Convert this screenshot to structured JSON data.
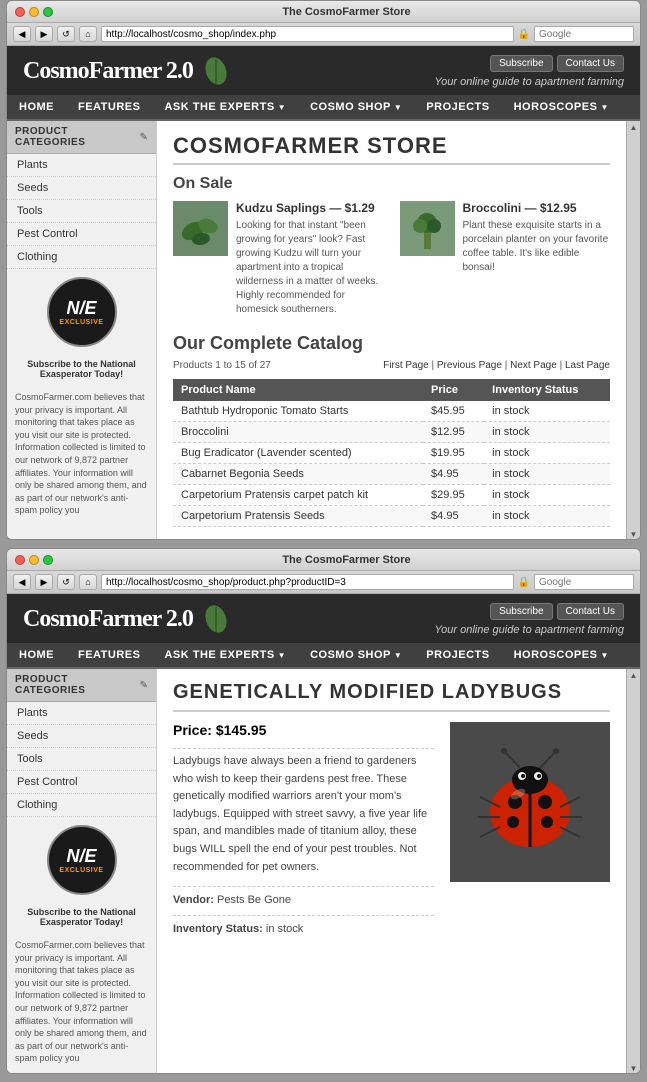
{
  "window1": {
    "title": "The CosmoFarmer Store",
    "url": "http://localhost/cosmo_shop/index.php",
    "search_placeholder": "Google",
    "header": {
      "logo": "CosmoFarmer 2.0",
      "tagline": "Your online guide to apartment farming",
      "subscribe_btn": "Subscribe",
      "contact_btn": "Contact Us"
    },
    "nav": [
      {
        "label": "HOME",
        "has_dropdown": false
      },
      {
        "label": "FEATURES",
        "has_dropdown": false
      },
      {
        "label": "ASK THE EXPERTS",
        "has_dropdown": true
      },
      {
        "label": "COSMO SHOP",
        "has_dropdown": true
      },
      {
        "label": "PROJECTS",
        "has_dropdown": false
      },
      {
        "label": "HOROSCOPES",
        "has_dropdown": true
      }
    ],
    "sidebar": {
      "header": "PRODUCT CATEGORIES",
      "items": [
        "Plants",
        "Seeds",
        "Tools",
        "Pest Control",
        "Clothing"
      ],
      "promo_logo": "N/E",
      "promo_line1": "Exclusive",
      "promo_subscribe": "Subscribe to the National Exasperator Today!",
      "disclaimer": "CosmoFarmer.com believes that your privacy is important. All monitoring that takes place as you visit our site is protected. Information collected is limited to our network of 9,872 partner affiliates. Your information will only be shared among them, and as part of our network's anti-spam policy you"
    },
    "main": {
      "page_title": "COSMOFARMER STORE",
      "on_sale_title": "On Sale",
      "featured": [
        {
          "name": "Kudzu Saplings — $1.29",
          "description": "Looking for that instant \"been growing for years\" look? Fast growing Kudzu will turn your apartment into a tropical wilderness in a matter of weeks. Highly recommended for homesick southerners."
        },
        {
          "name": "Broccolini — $12.95",
          "description": "Plant these exquisite starts in a porcelain planter on your favorite coffee table. It's like edible bonsai!"
        }
      ],
      "catalog_title": "Our Complete Catalog",
      "pagination_info": "Products 1 to 15 of 27",
      "pagination_links": "First Page | Previous Page | Next Page | Last Page",
      "table_headers": [
        "Product Name",
        "Price",
        "Inventory Status"
      ],
      "products": [
        {
          "name": "Bathtub Hydroponic Tomato Starts",
          "price": "$45.95",
          "status": "in stock"
        },
        {
          "name": "Broccolini",
          "price": "$12.95",
          "status": "in stock"
        },
        {
          "name": "Bug Eradicator (Lavender scented)",
          "price": "$19.95",
          "status": "in stock"
        },
        {
          "name": "Cabarnet Begonia Seeds",
          "price": "$4.95",
          "status": "in stock"
        },
        {
          "name": "Carpetorium Pratensis carpet patch kit",
          "price": "$29.95",
          "status": "in stock"
        },
        {
          "name": "Carpetorium Pratensis Seeds",
          "price": "$4.95",
          "status": "in stock"
        }
      ]
    }
  },
  "window2": {
    "title": "The CosmoFarmer Store",
    "url": "http://localhost/cosmo_shop/product.php?productID=3",
    "search_placeholder": "Google",
    "header": {
      "logo": "CosmoFarmer 2.0",
      "tagline": "Your online guide to apartment farming",
      "subscribe_btn": "Subscribe",
      "contact_btn": "Contact Us"
    },
    "nav": [
      {
        "label": "HOME",
        "has_dropdown": false
      },
      {
        "label": "FEATURES",
        "has_dropdown": false
      },
      {
        "label": "ASK THE EXPERTS",
        "has_dropdown": true
      },
      {
        "label": "COSMO SHOP",
        "has_dropdown": true
      },
      {
        "label": "PROJECTS",
        "has_dropdown": false
      },
      {
        "label": "HOROSCOPES",
        "has_dropdown": true
      }
    ],
    "sidebar": {
      "header": "PRODUCT CATEGORIES",
      "items": [
        "Plants",
        "Seeds",
        "Tools",
        "Pest Control",
        "Clothing"
      ],
      "promo_logo": "N/E",
      "promo_line1": "Exclusive",
      "promo_subscribe": "Subscribe to the National Exasperator Today!",
      "disclaimer": "CosmoFarmer.com believes that your privacy is important. All monitoring that takes place as you visit our site is protected. Information collected is limited to our network of 9,872 partner affiliates. Your information will only be shared among them, and as part of our network's anti-spam policy you"
    },
    "product": {
      "title": "GENETICALLY MODIFIED LADYBUGS",
      "price_label": "Price:",
      "price": "$145.95",
      "description": "Ladybugs have always been a friend to gardeners who wish to keep their gardens pest free. These genetically modified warriors aren't your mom's ladybugs. Equipped with street savvy, a five year life span, and mandibles made of titanium alloy, these bugs WILL spell the end of your pest troubles. Not recommended for pet owners.",
      "vendor_label": "Vendor:",
      "vendor": "Pests Be Gone",
      "inventory_label": "Inventory Status:",
      "inventory": "in stock"
    }
  }
}
